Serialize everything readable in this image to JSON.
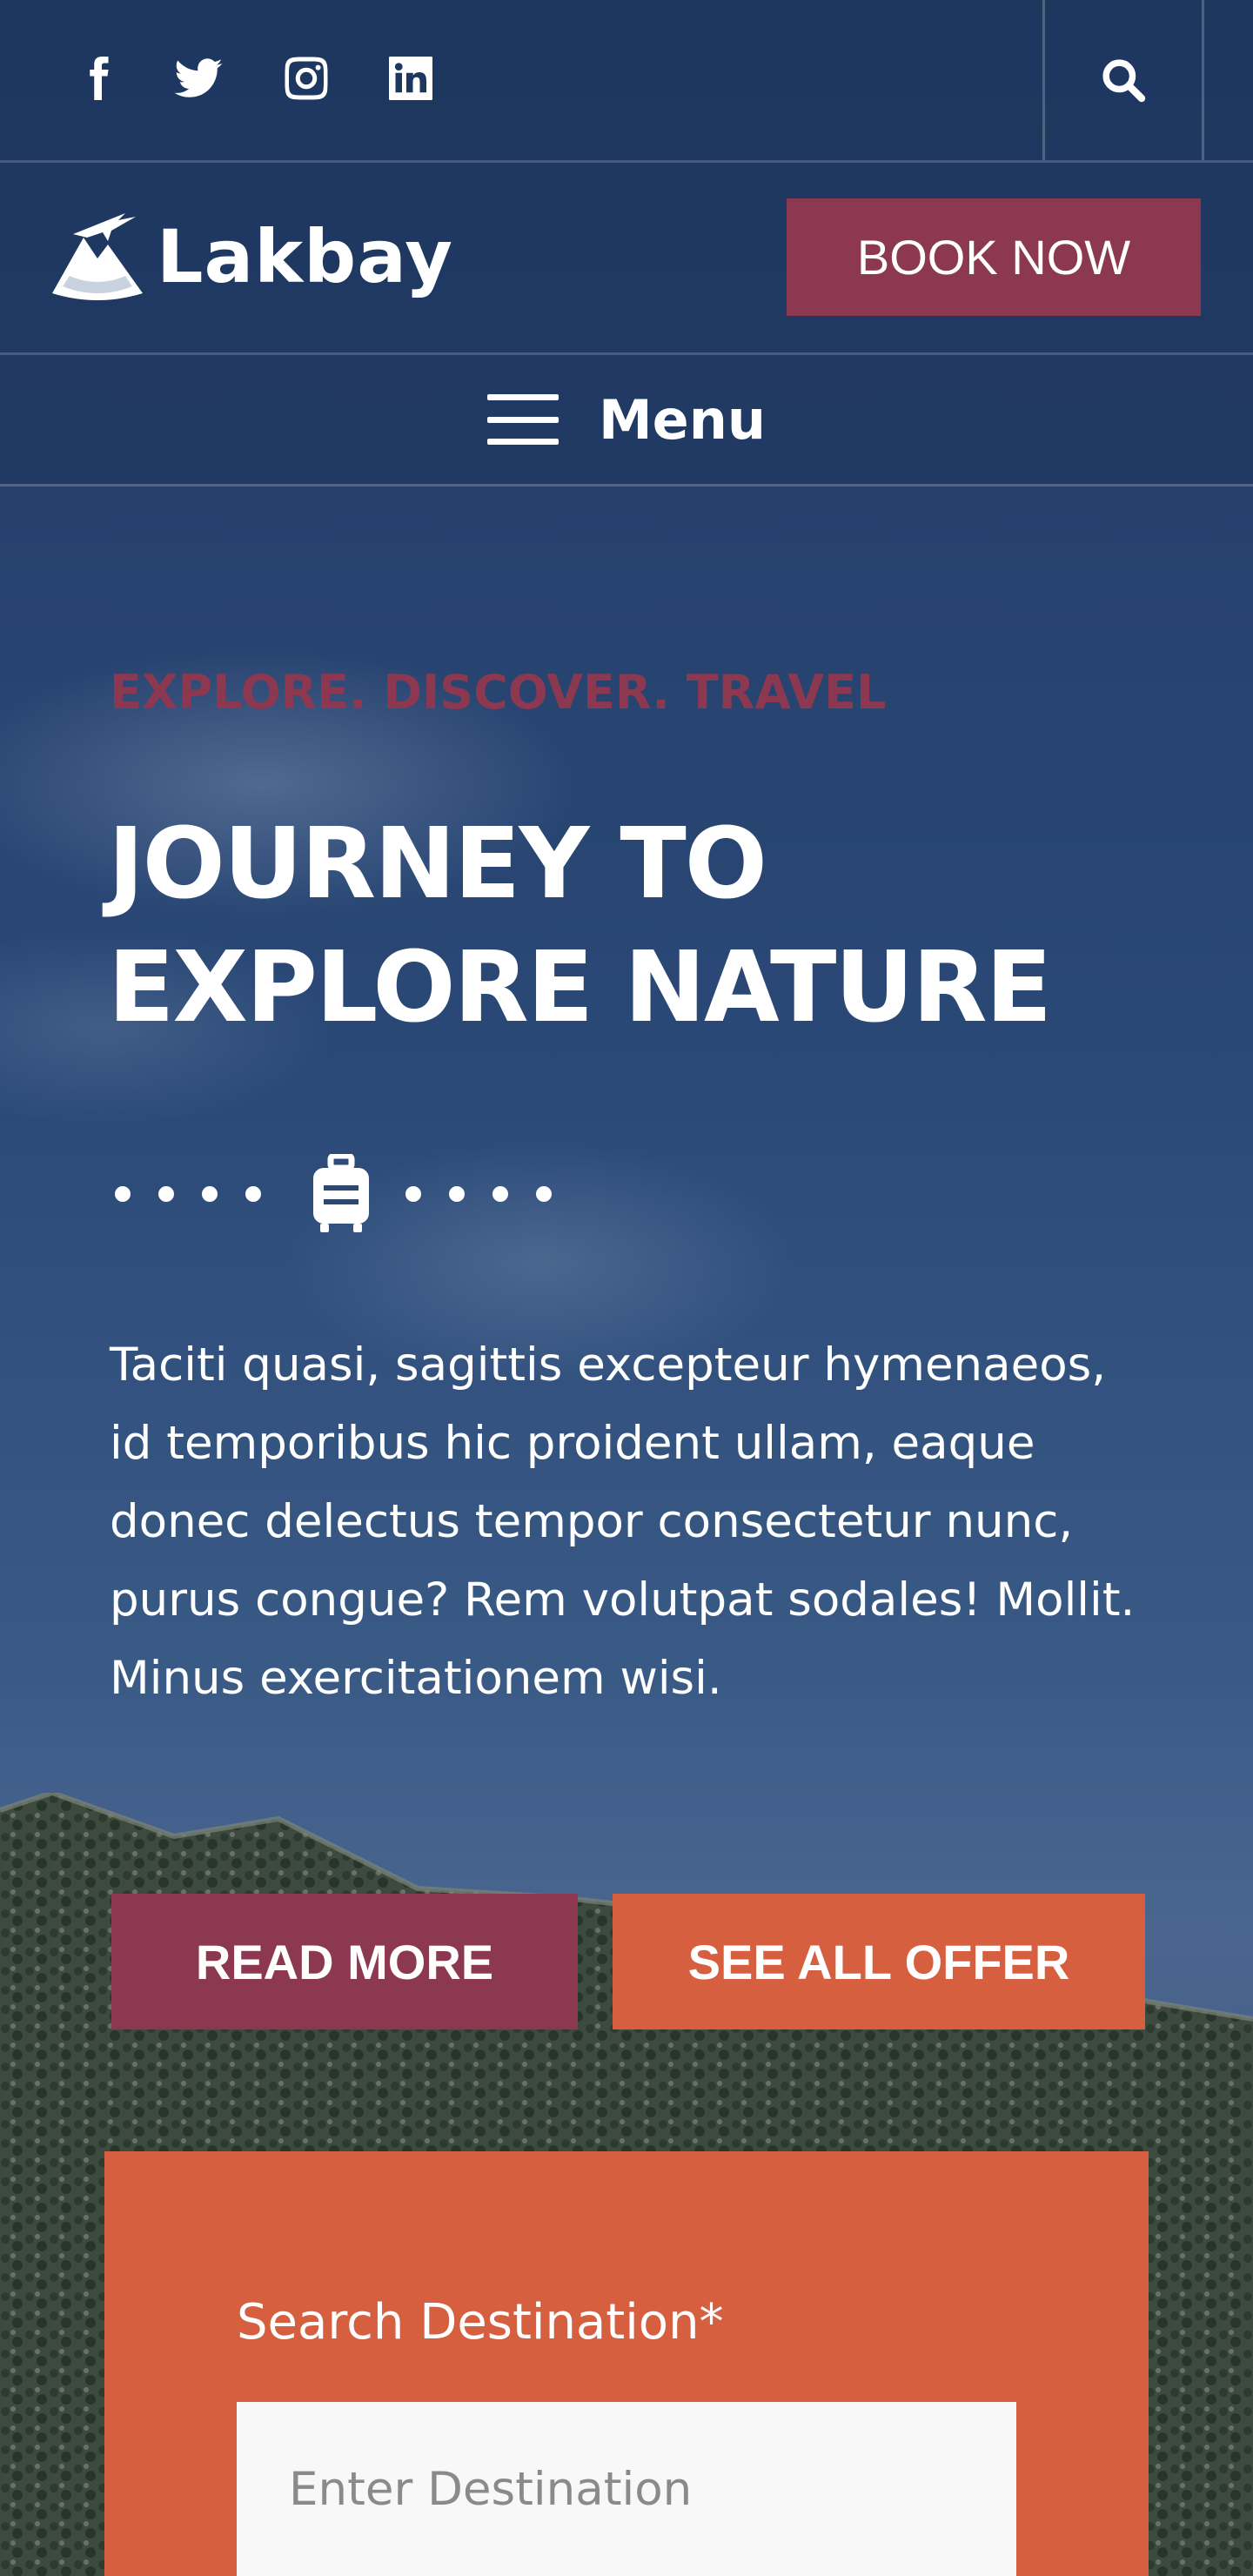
{
  "colors": {
    "navy": "#22385f",
    "maroon": "#8c3850",
    "orange": "#d55f3e",
    "white": "#ffffff"
  },
  "social": [
    {
      "icon": "facebook-icon"
    },
    {
      "icon": "twitter-icon"
    },
    {
      "icon": "instagram-icon"
    },
    {
      "icon": "linkedin-icon"
    }
  ],
  "header": {
    "search_icon": "search-icon",
    "logo_text": "Lakbay",
    "book_label": "BOOK NOW",
    "menu_label": "Menu"
  },
  "hero": {
    "tagline": "EXPLORE. DISCOVER. TRAVEL",
    "headline": "JOURNEY TO EXPLORE NATURE",
    "divider_icon": "luggage-icon",
    "paragraph": "Taciti quasi, sagittis excepteur hymenaeos, id temporibus hic proident ullam, eaque donec delectus tempor consectetur nunc, purus congue? Rem volutpat sodales! Mollit. Minus exercitationem wisi.",
    "read_more_label": "READ MORE",
    "offer_label": "SEE ALL OFFER"
  },
  "search": {
    "label": "Search Destination*",
    "placeholder": "Enter Destination",
    "value": ""
  }
}
